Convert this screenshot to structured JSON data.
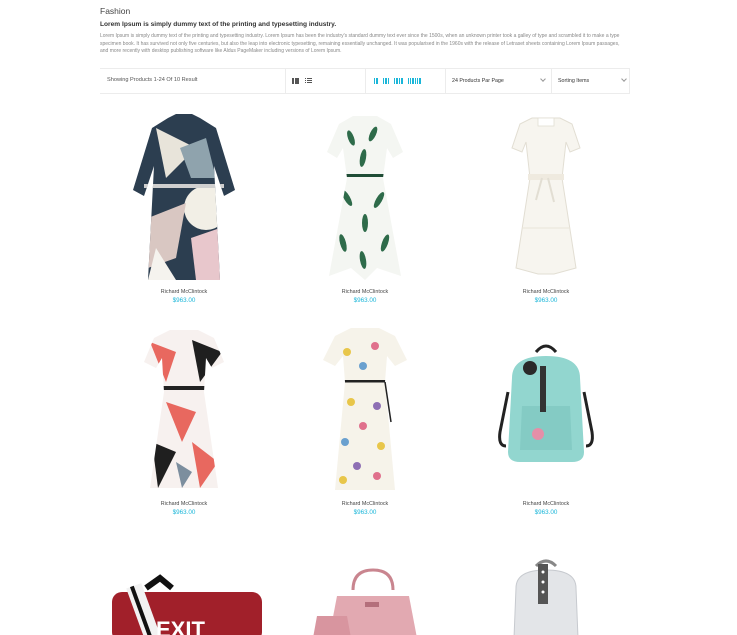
{
  "category": {
    "title": "Fashion",
    "subtitle": "Lorem Ipsum is simply dummy text of the printing and typesetting industry.",
    "description": "Lorem Ipsum is simply dummy text of the printing and typesetting industry. Lorem Ipsum has been the industry's standard dummy text ever since the 1500s, when an unknown printer took a galley of type and scrambled it to make a type specimen book. It has survived not only five centuries, but also the leap into electronic typesetting, remaining essentially unchanged. It was popularised in the 1960s with the release of Letraset sheets containing Lorem Ipsum passages, and more recently with desktop publishing software like Aldus PageMaker including versions of Lorem Ipsum."
  },
  "toolbar": {
    "result_text": "Showing Products 1-24 Of 10 Result",
    "per_page": "24 Products Par Page",
    "sorting": "Sorting Items",
    "accent_color": "#1ab6d9"
  },
  "products": [
    {
      "name": "Richard McClintock",
      "price": "$963.00",
      "image": "abstract-print-dress"
    },
    {
      "name": "Richard McClintock",
      "price": "$963.00",
      "image": "leaf-print-dress"
    },
    {
      "name": "Richard McClintock",
      "price": "$963.00",
      "image": "white-lace-dress"
    },
    {
      "name": "Richard McClintock",
      "price": "$963.00",
      "image": "coral-print-dress"
    },
    {
      "name": "Richard McClintock",
      "price": "$963.00",
      "image": "floral-print-dress"
    },
    {
      "name": "Richard McClintock",
      "price": "$963.00",
      "image": "mint-backpack"
    }
  ],
  "partial_products": [
    {
      "image": "red-exit-bag",
      "print": "EXIT"
    },
    {
      "image": "pink-handbag"
    },
    {
      "image": "white-backpack"
    }
  ]
}
